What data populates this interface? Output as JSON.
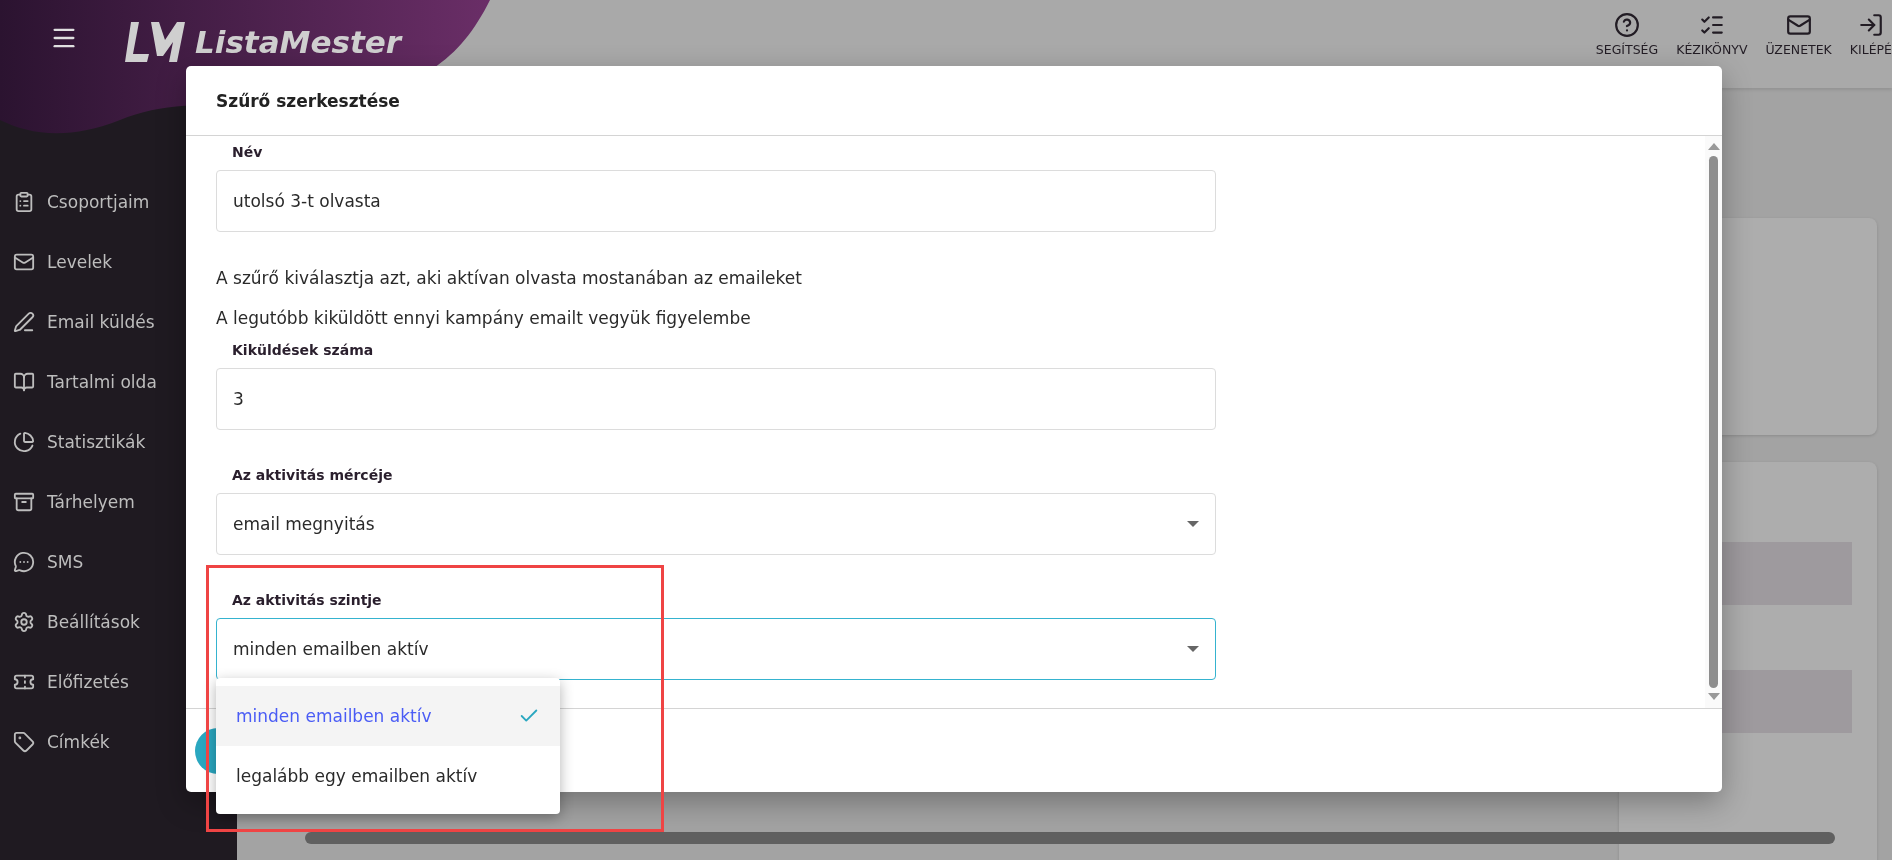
{
  "header": {
    "brand": "ListaMester",
    "actions": [
      {
        "label": "SEGÍTSÉG"
      },
      {
        "label": "KÉZIKÖNYV"
      },
      {
        "label": "ÜZENETEK"
      },
      {
        "label": "KILÉPÉ"
      }
    ]
  },
  "sidebar": {
    "items": [
      {
        "label": "Csoportjaim"
      },
      {
        "label": "Levelek"
      },
      {
        "label": "Email küldés"
      },
      {
        "label": "Tartalmi olda"
      },
      {
        "label": "Statisztikák"
      },
      {
        "label": "Tárhelyem"
      },
      {
        "label": "SMS"
      },
      {
        "label": "Beállítások"
      },
      {
        "label": "Előfizetés"
      },
      {
        "label": "Címkék"
      }
    ]
  },
  "dialog": {
    "title": "Szűrő szerkesztése",
    "fields": [
      {
        "kind": "input",
        "label": "Név",
        "value": "utolsó 3-t olvasta"
      },
      {
        "kind": "text",
        "text": "A szűrő kiválasztja azt, aki aktívan olvasta mostanában az emaileket"
      },
      {
        "kind": "text",
        "text": "A legutóbb kiküldött ennyi kampány emailt vegyük figyelembe"
      },
      {
        "kind": "input",
        "label": "Kiküldések száma",
        "value": "3"
      },
      {
        "kind": "select",
        "label": "Az aktivitás mércéje",
        "value": "email megnyitás",
        "focused": false
      },
      {
        "kind": "select",
        "label": "Az aktivitás szintje",
        "value": "minden emailben aktív",
        "focused": true
      }
    ],
    "dropdown": {
      "options": [
        {
          "label": "minden emailben aktív",
          "selected": true
        },
        {
          "label": "legalább egy emailben aktív",
          "selected": false
        }
      ]
    }
  }
}
